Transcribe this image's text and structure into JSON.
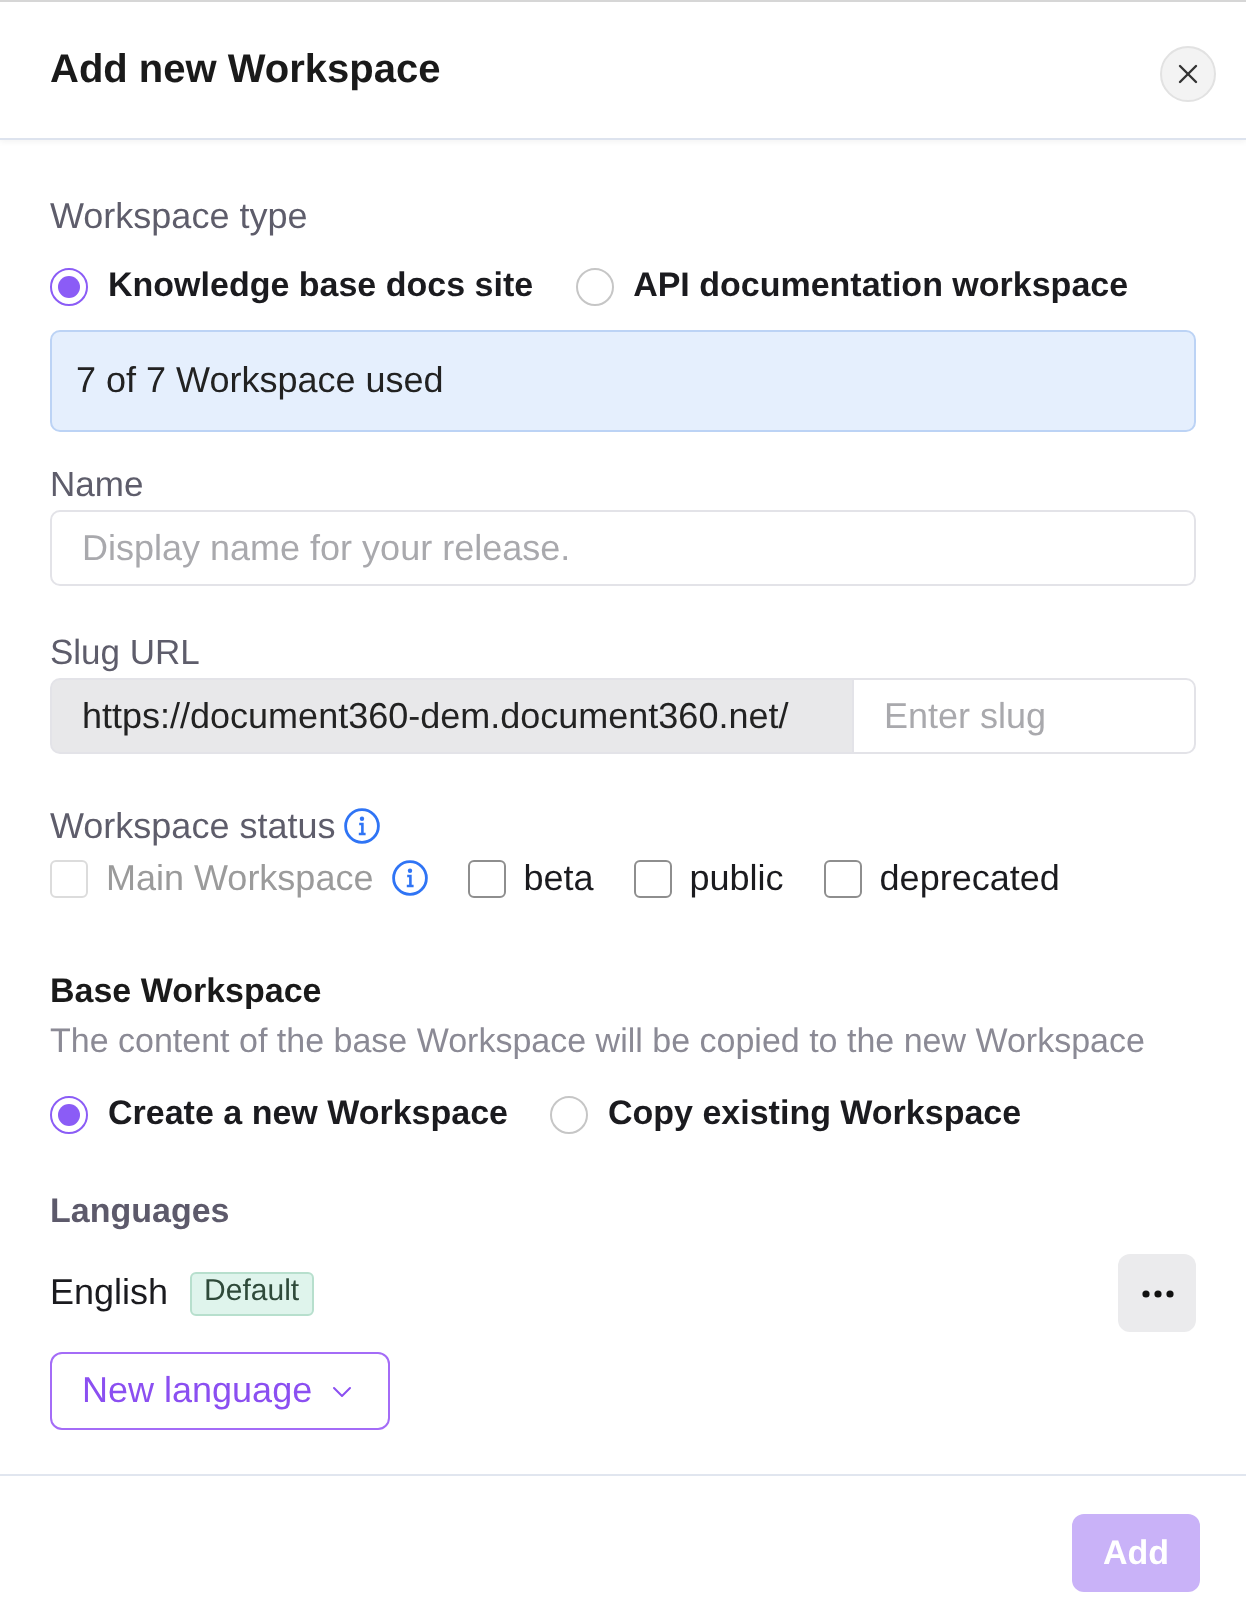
{
  "dialog": {
    "title": "Add new Workspace"
  },
  "workspace_type": {
    "label": "Workspace type",
    "options": [
      {
        "label": "Knowledge base docs site",
        "selected": true
      },
      {
        "label": "API documentation workspace",
        "selected": false
      }
    ]
  },
  "usage_notice": "7 of 7 Workspace used",
  "name_field": {
    "label": "Name",
    "placeholder": "Display name for your release."
  },
  "slug_field": {
    "label": "Slug URL",
    "prefix": "https://document360-dem.document360.net/",
    "placeholder": "Enter slug"
  },
  "workspace_status": {
    "label": "Workspace status",
    "info": true,
    "options": [
      {
        "label": "Main Workspace",
        "checked": false,
        "disabled": true,
        "info": true
      },
      {
        "label": "beta",
        "checked": false,
        "disabled": false,
        "info": false
      },
      {
        "label": "public",
        "checked": false,
        "disabled": false,
        "info": false
      },
      {
        "label": "deprecated",
        "checked": false,
        "disabled": false,
        "info": false
      }
    ]
  },
  "base_workspace": {
    "title": "Base Workspace",
    "description": "The content of the base Workspace will be copied to the new Workspace",
    "options": [
      {
        "label": "Create a new Workspace",
        "selected": true
      },
      {
        "label": "Copy existing Workspace",
        "selected": false
      }
    ]
  },
  "languages": {
    "label": "Languages",
    "items": [
      {
        "name": "English",
        "badge": "Default"
      }
    ],
    "add_button": "New language"
  },
  "footer": {
    "add_button": {
      "label": "Add",
      "disabled": true
    }
  }
}
